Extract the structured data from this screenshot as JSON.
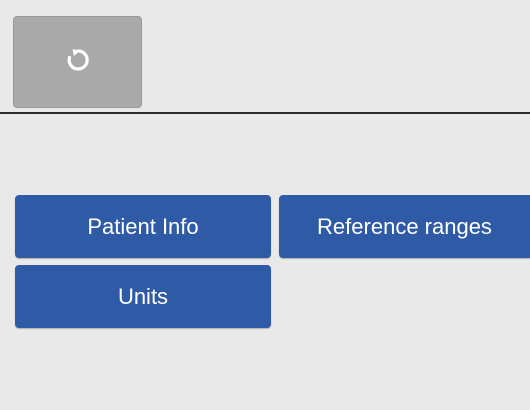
{
  "header": {
    "reset_icon": "refresh-icon"
  },
  "menu": {
    "patient_info_label": "Patient Info",
    "reference_ranges_label": "Reference ranges",
    "units_label": "Units"
  },
  "colors": {
    "button_blue": "#2f5aa6",
    "reset_button_gray": "#a9a9a9",
    "background": "#e9e9e9"
  }
}
